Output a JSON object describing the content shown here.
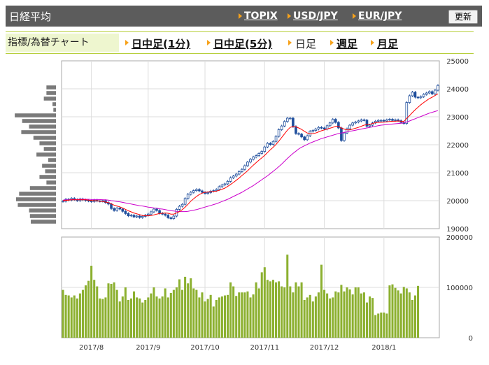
{
  "header": {
    "title": "日経平均",
    "links": [
      "TOPIX",
      "USD/JPY",
      "EUR/JPY"
    ],
    "refresh_label": "更新"
  },
  "subnav": {
    "label": "指標/為替チャート",
    "tabs": [
      {
        "label": "日中足(1分)",
        "active": false
      },
      {
        "label": "日中足(5分)",
        "active": false
      },
      {
        "label": "日足",
        "active": true
      },
      {
        "label": "週足",
        "active": false
      },
      {
        "label": "月足",
        "active": false
      }
    ]
  },
  "colors": {
    "accent_arrow": "#f7a21b",
    "candle_up": "#ffffff",
    "candle_down": "#1f4e9c",
    "ma_short": "#ff0000",
    "ma_long": "#cc00cc",
    "volume_bar": "#8cb030",
    "volume_profile": "#7a7a7a"
  },
  "chart_data": [
    {
      "type": "candlestick",
      "title": "",
      "ylim": [
        19000,
        25000
      ],
      "y_ticks": [
        "25000",
        "24000",
        "23000",
        "22000",
        "21000",
        "20000",
        "19000"
      ],
      "x_labels": [
        "2017/8",
        "2017/9",
        "2017/10",
        "2017/11",
        "2017/12",
        "2018/1"
      ],
      "grid": true,
      "close": [
        19980,
        20050,
        20020,
        20080,
        20040,
        20000,
        20060,
        20030,
        20010,
        19990,
        19970,
        20020,
        19990,
        19980,
        20000,
        19930,
        19880,
        19720,
        19650,
        19740,
        19700,
        19620,
        19540,
        19460,
        19480,
        19420,
        19450,
        19400,
        19440,
        19480,
        19520,
        19600,
        19700,
        19650,
        19550,
        19520,
        19480,
        19390,
        19360,
        19450,
        19690,
        19800,
        19870,
        20080,
        20230,
        20300,
        20360,
        20400,
        20350,
        20300,
        20260,
        20290,
        20340,
        20360,
        20400,
        20500,
        20560,
        20600,
        20690,
        20820,
        20880,
        20950,
        21040,
        21120,
        21250,
        21380,
        21480,
        21560,
        21610,
        21690,
        21760,
        21920,
        22050,
        22010,
        22120,
        22300,
        22540,
        22670,
        22830,
        22950,
        22950,
        22650,
        22400,
        22380,
        22280,
        22180,
        22320,
        22480,
        22510,
        22560,
        22620,
        22600,
        22560,
        22680,
        22780,
        22910,
        22800,
        22600,
        22150,
        22420,
        22570,
        22700,
        22780,
        22810,
        22850,
        22890,
        22880,
        22660,
        22700,
        22780,
        22840,
        22870,
        22870,
        22850,
        22890,
        22910,
        22870,
        22890,
        22860,
        22800,
        22760,
        23510,
        23750,
        23880,
        23700,
        23680,
        23720,
        23800,
        23850,
        23900,
        23820,
        23950,
        24120
      ],
      "ma_short": [
        20000,
        20010,
        20020,
        20030,
        20030,
        20030,
        20030,
        20030,
        20030,
        20020,
        20010,
        20000,
        20000,
        19980,
        19970,
        19950,
        19930,
        19890,
        19840,
        19810,
        19780,
        19740,
        19690,
        19640,
        19600,
        19560,
        19530,
        19500,
        19470,
        19460,
        19460,
        19470,
        19490,
        19520,
        19540,
        19550,
        19560,
        19550,
        19520,
        19520,
        19560,
        19610,
        19680,
        19770,
        19870,
        19980,
        20070,
        20150,
        20220,
        20270,
        20300,
        20310,
        20320,
        20330,
        20340,
        20370,
        20410,
        20450,
        20510,
        20580,
        20650,
        20730,
        20810,
        20900,
        20980,
        21070,
        21170,
        21270,
        21360,
        21450,
        21530,
        21620,
        21720,
        21820,
        21910,
        22010,
        22130,
        22260,
        22390,
        22520,
        22620,
        22650,
        22640,
        22600,
        22550,
        22480,
        22420,
        22390,
        22400,
        22420,
        22460,
        22500,
        22530,
        22560,
        22590,
        22620,
        22660,
        22660,
        22600,
        22560,
        22530,
        22530,
        22560,
        22590,
        22620,
        22660,
        22700,
        22720,
        22730,
        22760,
        22790,
        22800,
        22800,
        22810,
        22820,
        22830,
        22840,
        22840,
        22850,
        22840,
        22830,
        22940,
        23040,
        23150,
        23250,
        23340,
        23430,
        23510,
        23580,
        23650,
        23700,
        23760,
        23820
      ],
      "ma_long": [
        20020,
        20030,
        20030,
        20040,
        20040,
        20040,
        20050,
        20050,
        20050,
        20050,
        20040,
        20040,
        20040,
        20040,
        20030,
        20030,
        20020,
        20000,
        19990,
        19970,
        19960,
        19940,
        19920,
        19900,
        19880,
        19860,
        19840,
        19820,
        19810,
        19790,
        19770,
        19760,
        19740,
        19730,
        19710,
        19700,
        19680,
        19660,
        19640,
        19630,
        19620,
        19610,
        19610,
        19610,
        19620,
        19640,
        19660,
        19680,
        19710,
        19740,
        19770,
        19800,
        19830,
        19860,
        19890,
        19930,
        19970,
        20010,
        20050,
        20100,
        20150,
        20200,
        20250,
        20300,
        20360,
        20420,
        20480,
        20540,
        20610,
        20680,
        20750,
        20820,
        20890,
        20970,
        21050,
        21130,
        21220,
        21310,
        21410,
        21510,
        21600,
        21690,
        21770,
        21850,
        21910,
        21960,
        22010,
        22060,
        22100,
        22140,
        22180,
        22220,
        22250,
        22280,
        22310,
        22340,
        22370,
        22400,
        22420,
        22440,
        22460,
        22480,
        22500,
        22520,
        22540,
        22560,
        22580,
        22600,
        22620,
        22640,
        22660,
        22680,
        22700,
        22710,
        22720,
        22730,
        22740,
        22750,
        22760,
        22770,
        22780,
        22810,
        22850,
        22890,
        22930,
        22970,
        23010,
        23050,
        23090,
        23130,
        23160,
        23190,
        23220
      ],
      "price_volume_profile": [
        {
          "price": 24050,
          "value": 0.22
        },
        {
          "price": 23850,
          "value": 0.22
        },
        {
          "price": 23650,
          "value": 0.28
        },
        {
          "price": 23450,
          "value": 0.08
        },
        {
          "price": 23250,
          "value": 0.06
        },
        {
          "price": 23050,
          "value": 0.95
        },
        {
          "price": 22850,
          "value": 0.78
        },
        {
          "price": 22650,
          "value": 0.62
        },
        {
          "price": 22450,
          "value": 0.8
        },
        {
          "price": 22250,
          "value": 0.52
        },
        {
          "price": 22050,
          "value": 0.38
        },
        {
          "price": 21850,
          "value": 0.28
        },
        {
          "price": 21650,
          "value": 0.45
        },
        {
          "price": 21450,
          "value": 0.18
        },
        {
          "price": 21250,
          "value": 0.32
        },
        {
          "price": 21050,
          "value": 0.25
        },
        {
          "price": 20850,
          "value": 0.38
        },
        {
          "price": 20650,
          "value": 0.22
        },
        {
          "price": 20450,
          "value": 0.6
        },
        {
          "price": 20250,
          "value": 0.85
        },
        {
          "price": 20050,
          "value": 0.92
        },
        {
          "price": 19850,
          "value": 0.88
        },
        {
          "price": 19650,
          "value": 0.62
        },
        {
          "price": 19450,
          "value": 0.6
        },
        {
          "price": 19250,
          "value": 0.58
        }
      ]
    },
    {
      "type": "bar",
      "title": "",
      "ylim": [
        0,
        200000
      ],
      "y_ticks": [
        "200000",
        "100000",
        "0"
      ],
      "values": [
        95000,
        85000,
        84000,
        80000,
        84000,
        78000,
        88000,
        95000,
        104000,
        113000,
        143000,
        115000,
        102000,
        78000,
        77000,
        80000,
        108000,
        107000,
        110000,
        95000,
        72000,
        82000,
        100000,
        75000,
        78000,
        92000,
        80000,
        78000,
        70000,
        75000,
        80000,
        88000,
        100000,
        82000,
        78000,
        82000,
        98000,
        80000,
        89000,
        95000,
        100000,
        116000,
        95000,
        121000,
        108000,
        118000,
        98000,
        95000,
        80000,
        90000,
        72000,
        77000,
        85000,
        62000,
        75000,
        80000,
        82000,
        84000,
        85000,
        110000,
        102000,
        83000,
        90000,
        90000,
        90000,
        92000,
        80000,
        86000,
        110000,
        98000,
        130000,
        140000,
        115000,
        112000,
        115000,
        110000,
        112000,
        102000,
        100000,
        165000,
        102000,
        90000,
        110000,
        102000,
        110000,
        75000,
        80000,
        85000,
        72000,
        82000,
        90000,
        145000,
        95000,
        88000,
        78000,
        80000,
        92000,
        90000,
        105000,
        92000,
        100000,
        96000,
        86000,
        100000,
        100000,
        88000,
        90000,
        70000,
        82000,
        79000,
        45000,
        48000,
        50000,
        50000,
        48000,
        104000,
        106000,
        99000,
        94000,
        88000,
        101000,
        98000,
        90000,
        75000,
        84000,
        103000
      ]
    }
  ]
}
